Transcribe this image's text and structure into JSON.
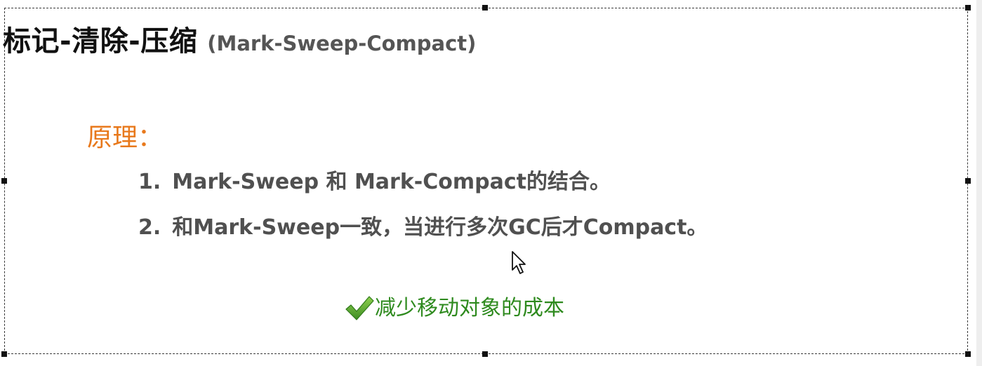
{
  "slide": {
    "title": "标记-清除-压缩",
    "title_en": "(Mark-Sweep-Compact)",
    "principle_label": "原理：",
    "points": [
      {
        "number": "1.",
        "text": "Mark-Sweep 和 Mark-Compact的结合。"
      },
      {
        "number": "2.",
        "text": "和Mark-Sweep一致，当进行多次GC后才Compact。"
      }
    ],
    "benefit": "减少移动对象的成本"
  },
  "colors": {
    "title": "#111111",
    "principle": "#e8791c",
    "points": "#505050",
    "benefit": "#2e8a1e",
    "check": "#5aa832"
  },
  "icons": {
    "benefit_icon": "checkmark-icon",
    "cursor": "mouse-pointer-icon"
  }
}
